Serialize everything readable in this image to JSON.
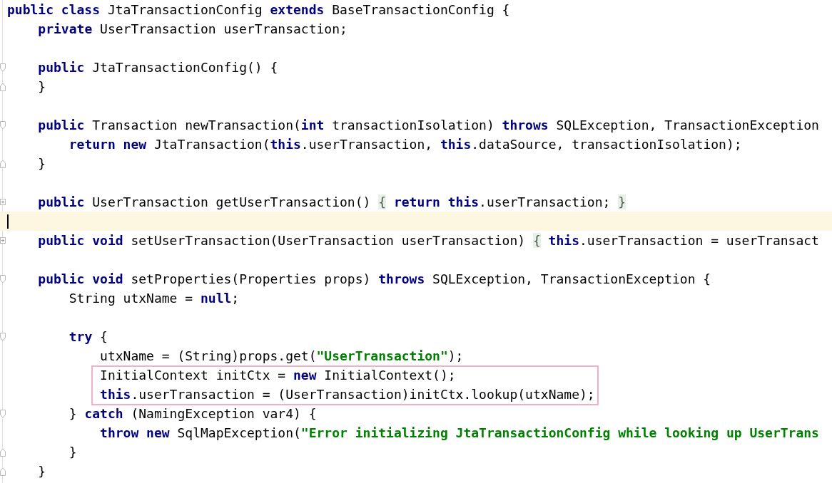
{
  "editor": {
    "lines": [
      {
        "kind": "code",
        "tokens": [
          {
            "kind": "keyword",
            "text": "public class"
          },
          {
            "kind": "plain",
            "text": " JtaTransactionConfig "
          },
          {
            "kind": "keyword",
            "text": "extends"
          },
          {
            "kind": "plain",
            "text": " BaseTransactionConfig {"
          }
        ],
        "children": [
          {
            "kind": "code",
            "tokens": [
              {
                "kind": "keyword",
                "text": "private"
              },
              {
                "kind": "plain",
                "text": " UserTransaction userTransaction;"
              }
            ]
          },
          {
            "kind": "blank"
          },
          {
            "kind": "fold_start",
            "tokens": [
              {
                "kind": "keyword",
                "text": "public"
              },
              {
                "kind": "plain",
                "text": " JtaTransactionConfig() {"
              }
            ]
          },
          {
            "kind": "fold_end",
            "tokens": [
              {
                "kind": "plain",
                "text": "}"
              }
            ]
          },
          {
            "kind": "blank"
          },
          {
            "kind": "fold_start",
            "tokens": [
              {
                "kind": "keyword",
                "text": "public"
              },
              {
                "kind": "plain",
                "text": " Transaction newTransaction("
              },
              {
                "kind": "keyword",
                "text": "int"
              },
              {
                "kind": "plain",
                "text": " transactionIsolation) "
              },
              {
                "kind": "keyword",
                "text": "throws"
              },
              {
                "kind": "plain",
                "text": " SQLException, TransactionException"
              }
            ],
            "children": [
              {
                "kind": "code",
                "tokens": [
                  {
                    "kind": "keyword",
                    "text": "return new"
                  },
                  {
                    "kind": "plain",
                    "text": " JtaTransaction("
                  },
                  {
                    "kind": "keyword",
                    "text": "this"
                  },
                  {
                    "kind": "plain",
                    "text": ".userTransaction, "
                  },
                  {
                    "kind": "keyword",
                    "text": "this"
                  },
                  {
                    "kind": "plain",
                    "text": ".dataSource, transactionIsolation);"
                  }
                ]
              }
            ]
          },
          {
            "kind": "fold_end",
            "tokens": [
              {
                "kind": "plain",
                "text": "}"
              }
            ]
          },
          {
            "kind": "blank"
          },
          {
            "kind": "folded",
            "tokens": [
              {
                "kind": "keyword",
                "text": "public"
              },
              {
                "kind": "plain",
                "text": " UserTransaction getUserTransaction() "
              },
              {
                "kind": "brace",
                "text": "{"
              },
              {
                "kind": "keyword",
                "text": " return this"
              },
              {
                "kind": "plain",
                "text": ".userTransaction; "
              },
              {
                "kind": "brace",
                "text": "}"
              }
            ]
          },
          {
            "kind": "blank",
            "current": true
          },
          {
            "kind": "folded",
            "tokens": [
              {
                "kind": "keyword",
                "text": "public void"
              },
              {
                "kind": "plain",
                "text": " setUserTransaction(UserTransaction userTransaction) "
              },
              {
                "kind": "brace",
                "text": "{"
              },
              {
                "kind": "keyword",
                "text": " this"
              },
              {
                "kind": "plain",
                "text": ".userTransaction = userTransact"
              }
            ]
          },
          {
            "kind": "blank"
          },
          {
            "kind": "fold_start",
            "tokens": [
              {
                "kind": "keyword",
                "text": "public void"
              },
              {
                "kind": "plain",
                "text": " setProperties(Properties props) "
              },
              {
                "kind": "keyword",
                "text": "throws"
              },
              {
                "kind": "plain",
                "text": " SQLException, TransactionException {"
              }
            ],
            "children": [
              {
                "kind": "code",
                "tokens": [
                  {
                    "kind": "plain",
                    "text": "String utxName = "
                  },
                  {
                    "kind": "keyword",
                    "text": "null"
                  },
                  {
                    "kind": "plain",
                    "text": ";"
                  }
                ]
              },
              {
                "kind": "blank"
              },
              {
                "kind": "fold_start",
                "tokens": [
                  {
                    "kind": "keyword",
                    "text": "try"
                  },
                  {
                    "kind": "plain",
                    "text": " {"
                  }
                ],
                "children": [
                  {
                    "kind": "code",
                    "tokens": [
                      {
                        "kind": "plain",
                        "text": "utxName = (String)props.get("
                      },
                      {
                        "kind": "string",
                        "text": "\"UserTransaction\""
                      },
                      {
                        "kind": "plain",
                        "text": ");"
                      }
                    ]
                  },
                  {
                    "kind": "code",
                    "boxed": true,
                    "tokens": [
                      {
                        "kind": "plain",
                        "text": "InitialContext initCtx = "
                      },
                      {
                        "kind": "keyword",
                        "text": "new"
                      },
                      {
                        "kind": "plain",
                        "text": " InitialContext();"
                      }
                    ]
                  },
                  {
                    "kind": "code",
                    "boxed": true,
                    "tokens": [
                      {
                        "kind": "keyword",
                        "text": "this"
                      },
                      {
                        "kind": "plain",
                        "text": ".userTransaction = (UserTransaction)initCtx.lookup(utxName);"
                      }
                    ]
                  }
                ]
              },
              {
                "kind": "fold_start",
                "tokens": [
                  {
                    "kind": "plain",
                    "text": "} "
                  },
                  {
                    "kind": "keyword",
                    "text": "catch"
                  },
                  {
                    "kind": "plain",
                    "text": " (NamingException var4) {"
                  }
                ],
                "children": [
                  {
                    "kind": "code",
                    "tokens": [
                      {
                        "kind": "keyword",
                        "text": "throw new"
                      },
                      {
                        "kind": "plain",
                        "text": " SqlMapException("
                      },
                      {
                        "kind": "string",
                        "text": "\"Error initializing JtaTransactionConfig while looking up UserTrans"
                      }
                    ]
                  }
                ]
              },
              {
                "kind": "fold_end",
                "tokens": [
                  {
                    "kind": "plain",
                    "text": "}"
                  }
                ]
              }
            ]
          },
          {
            "kind": "fold_end",
            "tokens": [
              {
                "kind": "plain",
                "text": "}"
              }
            ]
          }
        ]
      }
    ]
  }
}
